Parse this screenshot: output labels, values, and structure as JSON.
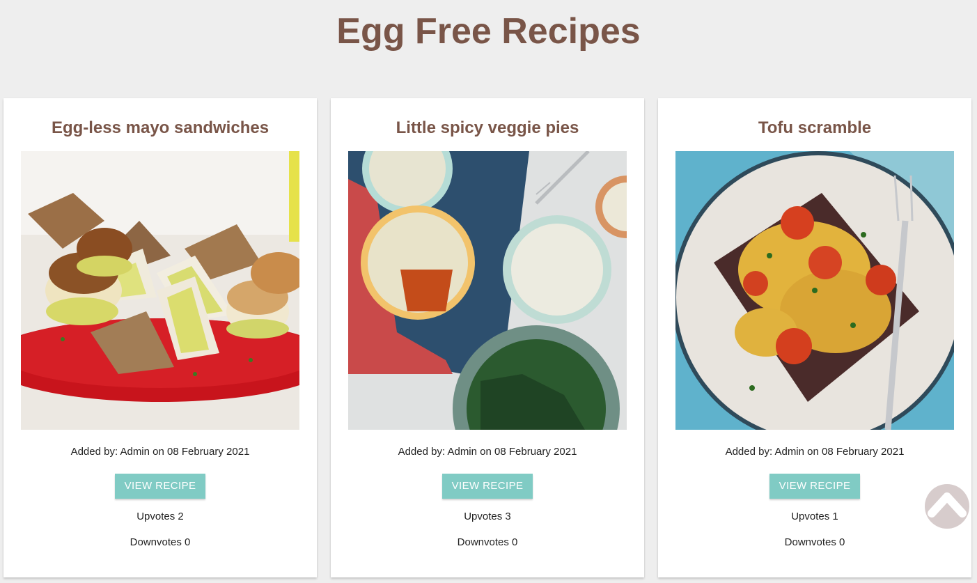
{
  "page": {
    "title": "Egg Free Recipes"
  },
  "recipes": [
    {
      "title": "Egg-less mayo sandwiches",
      "added_by": "Added by: Admin on 08 February 2021",
      "button_label": "View Recipe",
      "upvotes": "Upvotes 2",
      "downvotes": "Downvotes 0"
    },
    {
      "title": "Little spicy veggie pies",
      "added_by": "Added by: Admin on 08 February 2021",
      "button_label": "View Recipe",
      "upvotes": "Upvotes 3",
      "downvotes": "Downvotes 0"
    },
    {
      "title": "Tofu scramble",
      "added_by": "Added by: Admin on 08 February 2021",
      "button_label": "View Recipe",
      "upvotes": "Upvotes 1",
      "downvotes": "Downvotes 0"
    }
  ],
  "scroll_top": {
    "icon": "chevron-up-icon"
  },
  "colors": {
    "background": "#eeeeee",
    "title": "#795548",
    "button": "#80cbc4",
    "scroll_top": "#d7cccc"
  }
}
